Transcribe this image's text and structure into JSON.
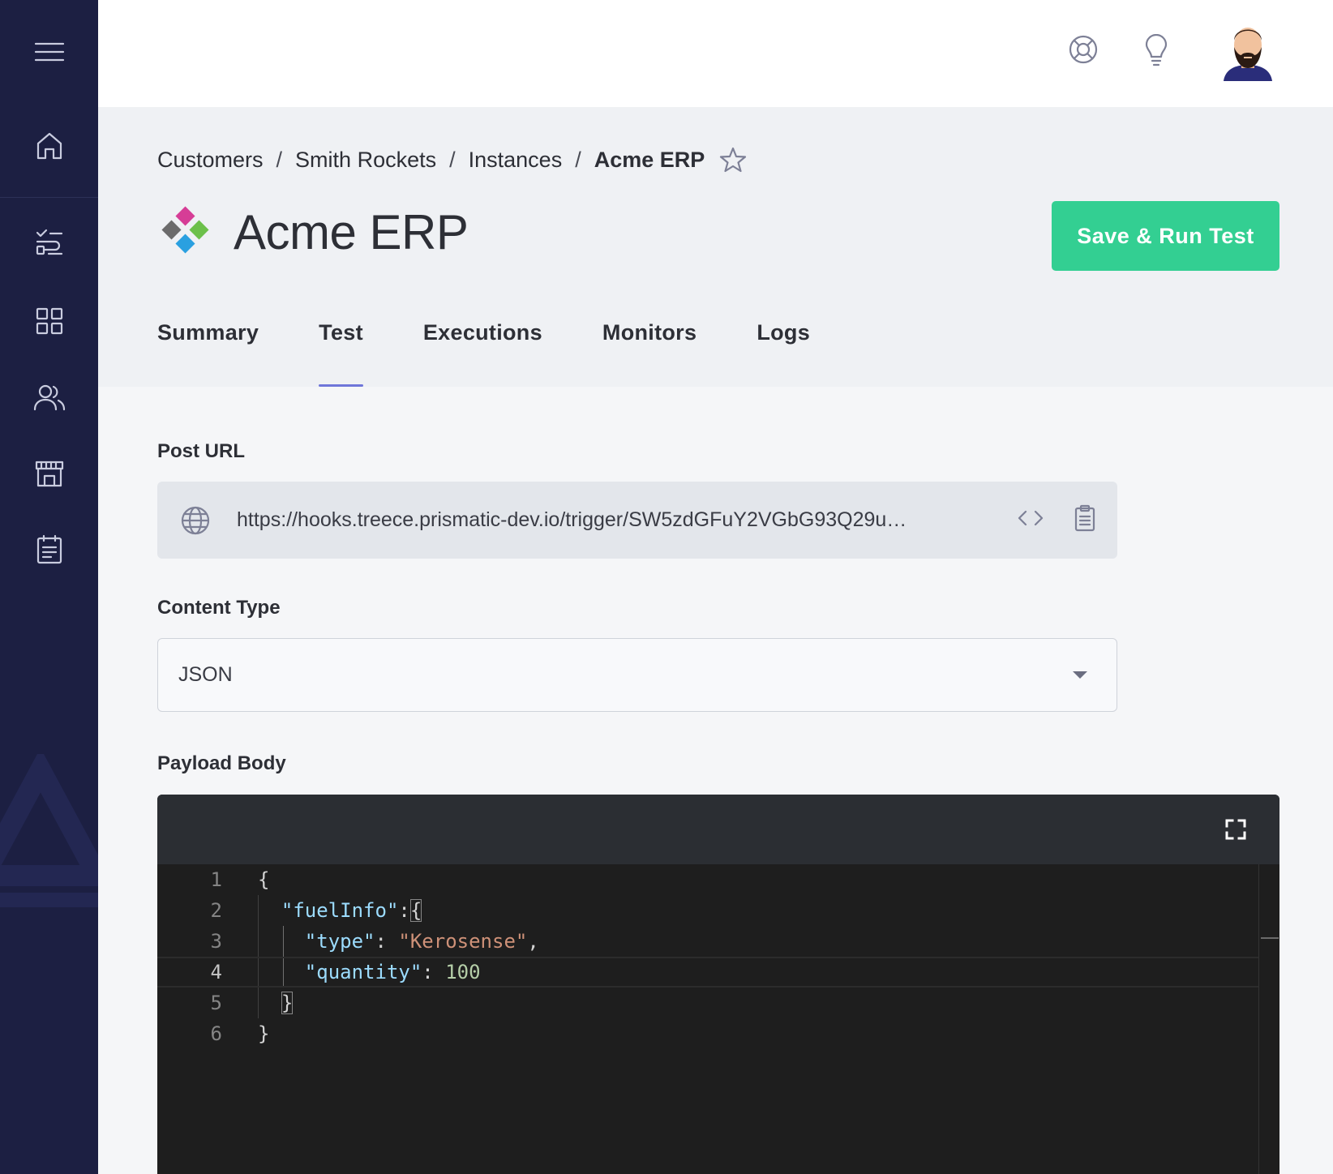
{
  "sidebar": {
    "items": [
      {
        "icon": "menu-icon"
      },
      {
        "icon": "home-icon"
      },
      {
        "icon": "integrations-icon"
      },
      {
        "icon": "marketplace-grid-icon"
      },
      {
        "icon": "customers-icon"
      },
      {
        "icon": "store-icon"
      },
      {
        "icon": "logs-clipboard-icon"
      }
    ]
  },
  "topbar": {
    "icons": [
      "help-lifebuoy-icon",
      "lightbulb-icon",
      "user-avatar"
    ]
  },
  "breadcrumb": {
    "items": [
      "Customers",
      "Smith Rockets",
      "Instances"
    ],
    "current": "Acme ERP",
    "separator": "/"
  },
  "page": {
    "title": "Acme ERP",
    "primary_action": "Save & Run Test"
  },
  "tabs": [
    {
      "label": "Summary",
      "active": false
    },
    {
      "label": "Test",
      "active": true
    },
    {
      "label": "Executions",
      "active": false
    },
    {
      "label": "Monitors",
      "active": false
    },
    {
      "label": "Logs",
      "active": false
    }
  ],
  "form": {
    "post_url": {
      "label": "Post URL",
      "value": "https://hooks.treece.prismatic-dev.io/trigger/SW5zdGFuY2VGbG93Q29u…"
    },
    "content_type": {
      "label": "Content Type",
      "value": "JSON"
    },
    "payload": {
      "label": "Payload Body",
      "lines": [
        {
          "n": "1",
          "text": "{"
        },
        {
          "n": "2",
          "text": "  \"fuelInfo\":{"
        },
        {
          "n": "3",
          "text": "    \"type\": \"Kerosense\","
        },
        {
          "n": "4",
          "text": "    \"quantity\": 100"
        },
        {
          "n": "5",
          "text": "  }"
        },
        {
          "n": "6",
          "text": "}"
        }
      ],
      "current_line": 4
    }
  },
  "colors": {
    "sidebar": "#1c1f42",
    "primary": "#33cf92",
    "tab_indicator": "#6f76d9",
    "editor_bg": "#1e1e1e"
  }
}
